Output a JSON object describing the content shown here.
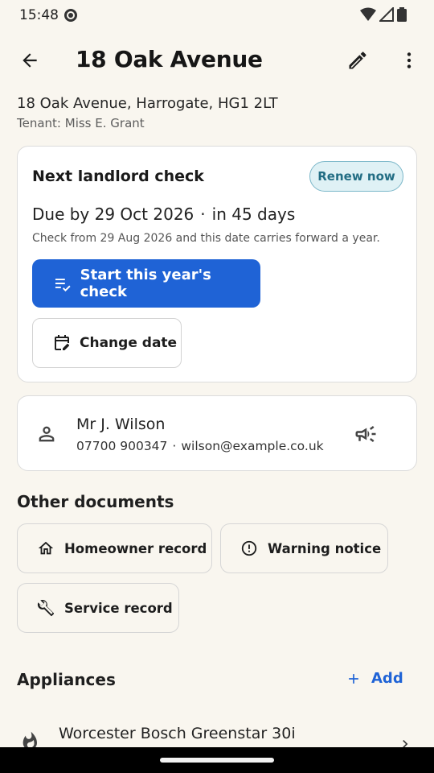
{
  "status_bar": {
    "time": "15:48"
  },
  "app_bar": {
    "title": "18 Oak Avenue"
  },
  "property": {
    "address": "18 Oak Avenue, Harrogate, HG1 2LT",
    "tenant": "Tenant: Miss E. Grant"
  },
  "check_card": {
    "title": "Next landlord check",
    "badge": "Renew now",
    "due": "Due by 29 Oct 2026",
    "separator": "·",
    "days": "in 45 days",
    "note": "Check from 29 Aug 2026 and this date carries forward a year.",
    "start_label": "Start this year's check",
    "change_label": "Change date"
  },
  "contact": {
    "name": "Mr J. Wilson",
    "phone": "07700 900347",
    "separator": "·",
    "email": "wilson@example.co.uk"
  },
  "other_documents": {
    "title": "Other documents",
    "items": [
      "Homeowner record",
      "Warning notice",
      "Service record"
    ]
  },
  "appliances": {
    "title": "Appliances",
    "add_label": "Add",
    "items": [
      "Worcester Bosch Greenstar 30i"
    ]
  },
  "colors": {
    "background": "#f9f6ef",
    "primary": "#1f63d6",
    "badge_bg": "#dff1f5",
    "badge_text": "#226d84"
  }
}
